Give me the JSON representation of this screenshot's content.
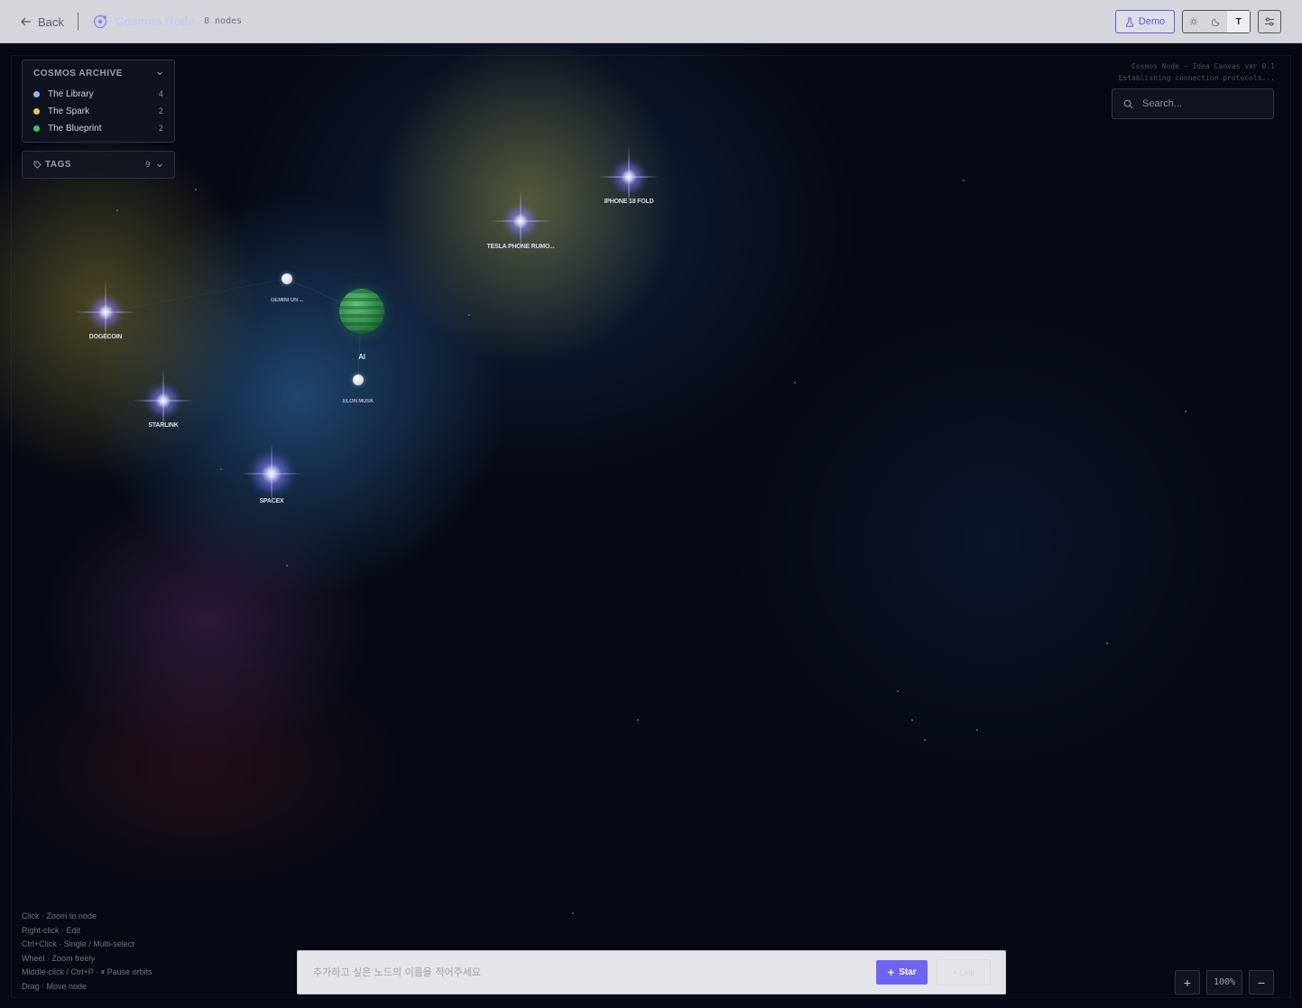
{
  "topbar": {
    "back_label": "Back",
    "app_title": "Cosmos Node",
    "node_count": "8 nodes",
    "demo_label": "Demo",
    "theme_text_label": "T"
  },
  "console": {
    "line1": "Cosmos Node — Idea Canvas ver 0.1",
    "line2": "Establishing connection protocols..."
  },
  "search": {
    "placeholder": "Search..."
  },
  "archive": {
    "title": "COSMOS ARCHIVE",
    "categories": [
      {
        "label": "The Library",
        "count": "4",
        "color": "#8fb8f0"
      },
      {
        "label": "The Spark",
        "count": "2",
        "color": "#f0c23a"
      },
      {
        "label": "The Blueprint",
        "count": "2",
        "color": "#3fbf6a"
      }
    ]
  },
  "tags": {
    "title": "TAGS",
    "count": "9"
  },
  "nodes": {
    "iphone": "IPHONE 18 FOLD",
    "tesla": "TESLA PHONE RUMO...",
    "gemini": "GEMINI ON ...",
    "ai": "AI",
    "elon": "ELON MUSK",
    "dogecoin": "DOGECOIN",
    "starlink": "STARLINK",
    "spacex": "SPACEX"
  },
  "help": {
    "line1": "Click · Zoom to node",
    "line2": "Right-click · Edit",
    "line3": "Ctrl+Click · Single / Multi-select",
    "line4": "Wheel · Zoom freely",
    "line5": "Middle-click / Ctrl+P · ⏸ Pause orbits",
    "line6": "Drag · Move node"
  },
  "add_bar": {
    "placeholder": "추가하고 싶은 노드의 이름을 적어주세요",
    "star_label": "Star",
    "ghost_label": "+ Link"
  },
  "zoom": {
    "plus": "+",
    "level": "100%",
    "minus": "−"
  },
  "colors": {
    "accent": "#6f63f2",
    "demo": "#5b5fd1"
  },
  "icons": [
    "arrow-left-icon",
    "orbit-icon",
    "flask-icon",
    "sun-icon",
    "moon-icon",
    "sliders-icon",
    "search-icon",
    "chevron-down-icon",
    "tag-icon",
    "plus-icon"
  ]
}
